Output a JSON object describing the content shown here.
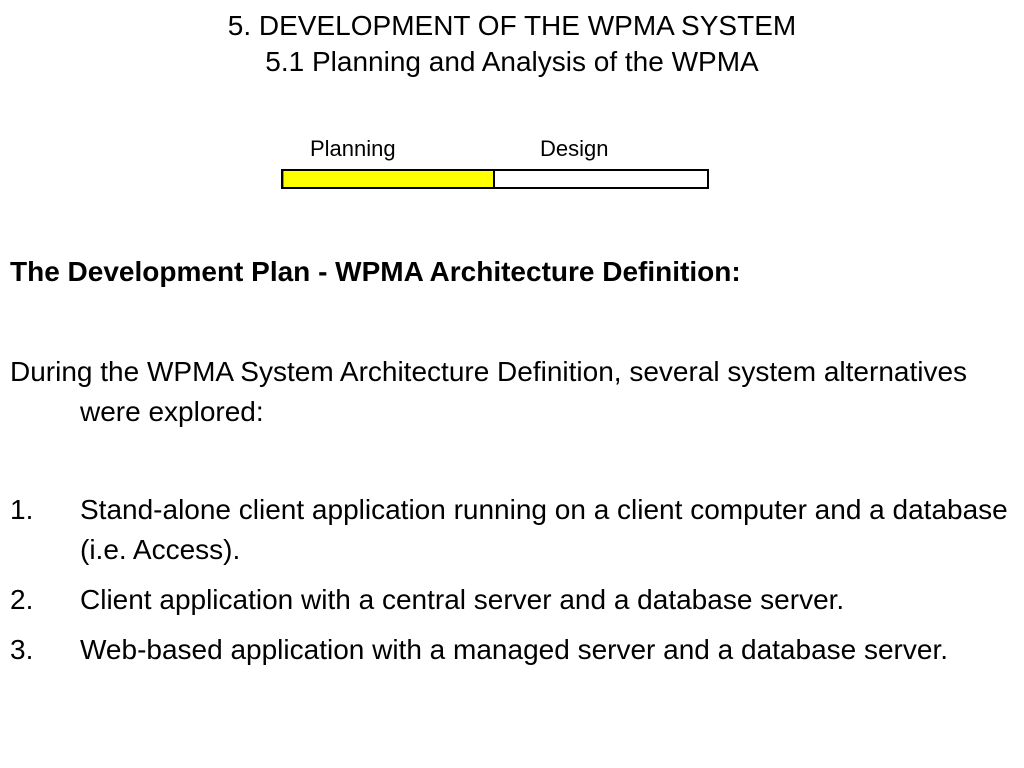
{
  "title": {
    "line1": "5. DEVELOPMENT OF THE WPMA SYSTEM",
    "line2": "5.1 Planning and Analysis of the WPMA"
  },
  "phase_bar": {
    "planning_label": "Planning",
    "design_label": "Design",
    "planning_color": "#ffff00",
    "design_color": "#ffffff",
    "completed_fraction": 0.5
  },
  "section_heading": "The Development Plan - WPMA Architecture Definition:",
  "intro": "During the WPMA System Architecture Definition, several system alternatives were explored:",
  "alternatives": [
    {
      "number": "1.",
      "text": "Stand-alone client application running on a client computer and a database (i.e. Access)."
    },
    {
      "number": "2.",
      "text": "Client application with a central server and a database server."
    },
    {
      "number": "3.",
      "text": "Web-based application with a managed server and a database server."
    }
  ]
}
